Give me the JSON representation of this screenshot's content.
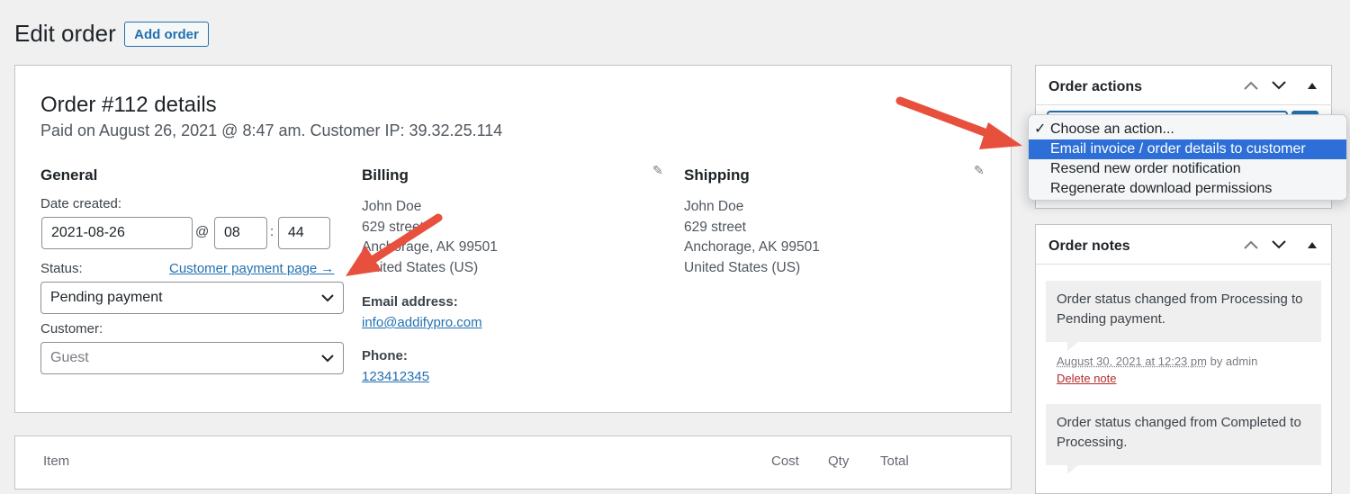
{
  "header": {
    "title": "Edit order",
    "add_order": "Add order"
  },
  "order": {
    "heading": "Order #112 details",
    "meta": "Paid on August 26, 2021 @ 8:47 am. Customer IP: 39.32.25.114",
    "general": {
      "heading": "General",
      "date_label": "Date created:",
      "date_value": "2021-08-26",
      "at_sep": "@",
      "hour": "08",
      "colon": ":",
      "minute": "44",
      "status_label": "Status:",
      "customer_payment_link": "Customer payment page →",
      "status_value": "Pending payment",
      "customer_label": "Customer:",
      "customer_value": "Guest"
    },
    "billing": {
      "heading": "Billing",
      "lines": [
        "John Doe",
        "629 street",
        "Anchorage, AK 99501",
        "United States (US)"
      ],
      "email_label": "Email address:",
      "email": "info@addifypro.com",
      "phone_label": "Phone:",
      "phone": "123412345"
    },
    "shipping": {
      "heading": "Shipping",
      "lines": [
        "John Doe",
        "629 street",
        "Anchorage, AK 99501",
        "United States (US)"
      ]
    }
  },
  "items_table": {
    "columns": [
      "Item",
      "Cost",
      "Qty",
      "Total"
    ]
  },
  "order_actions": {
    "title": "Order actions",
    "menu": [
      {
        "label": "Choose an action...",
        "checked": true
      },
      {
        "label": "Email invoice / order details to customer",
        "highlighted": true
      },
      {
        "label": "Resend new order notification"
      },
      {
        "label": "Regenerate download permissions"
      }
    ],
    "check_mark": "✓"
  },
  "order_notes": {
    "title": "Order notes",
    "notes": [
      {
        "text": "Order status changed from Processing to Pending payment.",
        "date": "August 30, 2021 at 12:23 pm",
        "by": "by admin",
        "delete": "Delete note"
      },
      {
        "text": "Order status changed from Completed to Processing."
      }
    ]
  },
  "colors": {
    "accent": "#2271b1",
    "arrow": "#e8503e",
    "menu_highlight": "#2d6fd6",
    "delete": "#b32d2e"
  }
}
